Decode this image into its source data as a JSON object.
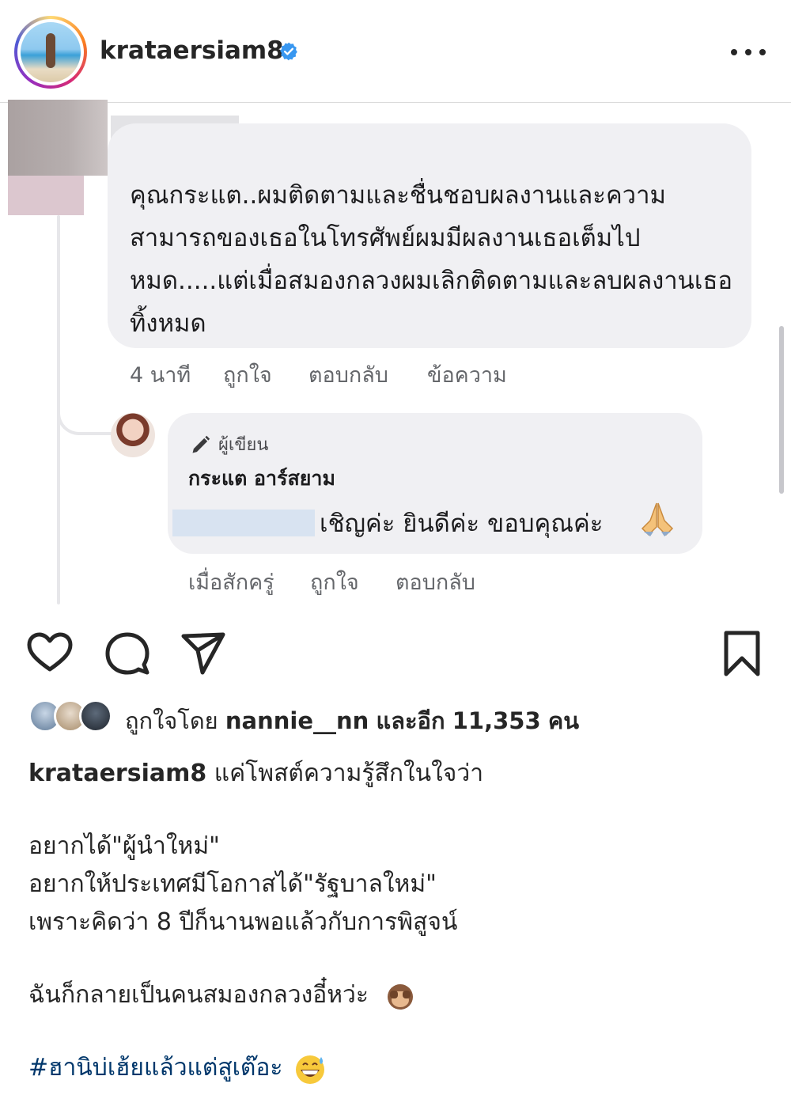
{
  "header": {
    "username": "krataersiam8"
  },
  "comment": {
    "text": "คุณกระแต..ผมติดตามและชื่นชอบผลงานและความสามารถของเธอในโทรศัพย์ผมมีผลงานเธอเต็มไปหมด.....แต่เมื่อสมองกลวงผมเลิกติดตามและลบผลงานเธอทิ้งหมด",
    "time": "4 นาที",
    "like": "ถูกใจ",
    "reply": "ตอบกลับ",
    "message": "ข้อความ"
  },
  "reply": {
    "badge": "ผู้เขียน",
    "name": "กระแต อาร์สยาม",
    "text": "เชิญค่ะ ยินดีค่ะ ขอบคุณค่ะ",
    "time": "เมื่อสักครู่",
    "like": "ถูกใจ",
    "reply": "ตอบกลับ"
  },
  "likes": {
    "prefix": "ถูกใจโดย",
    "user": "nannie__nn",
    "middle": "และอีก",
    "count": "11,353",
    "suffix": "คน"
  },
  "caption": {
    "username": "krataersiam8",
    "line1": "แค่โพสต์ความรู้สึกในใจว่า",
    "line2": "อยากได้\"ผู้นำใหม่\"",
    "line3": "อยากให้ประเทศมีโอกาสได้\"รัฐบาลใหม่\"",
    "line4": "เพราะคิดว่า 8 ปีก็นานพอแล้วกับการพิสูจน์",
    "line5": "ฉันก็กลายเป็นคนสมองกลวงอี๋หว่ะ",
    "hashtag": "#ฮานิบ่เฮ้ยแล้วแต่สูเต๊อะ"
  },
  "icons": {
    "verified": "verified-badge-icon",
    "more": "more-options-icon",
    "like": "heart-icon",
    "comment": "comment-bubble-icon",
    "share": "paper-plane-icon",
    "save": "bookmark-icon",
    "author": "pen-icon",
    "pray": "folded-hands-emoji",
    "monkey": "see-no-evil-monkey-emoji",
    "sweat": "grinning-sweat-emoji"
  },
  "colors": {
    "verified": "#3897f0",
    "hashtag": "#00376b",
    "bubble": "#f0f0f3"
  }
}
